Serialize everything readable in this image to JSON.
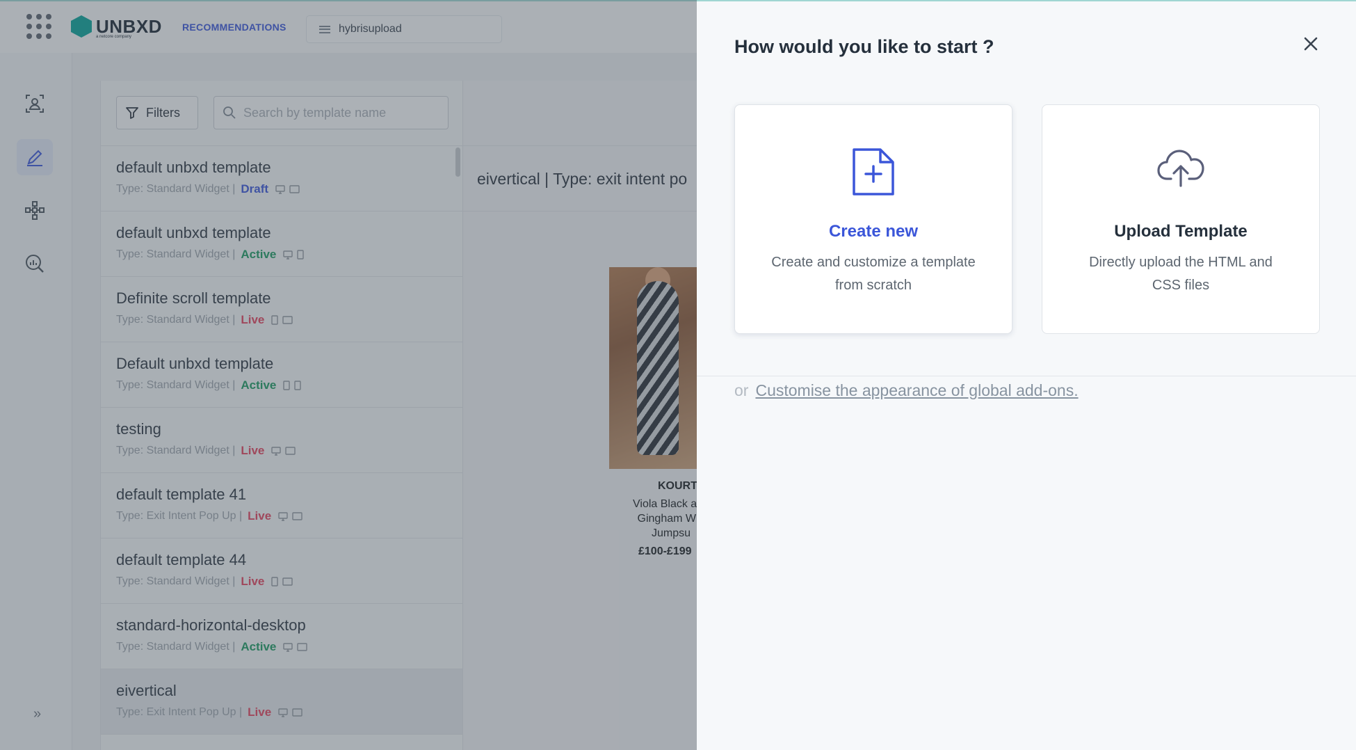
{
  "topbar": {
    "brand": "UNBXD",
    "brand_sub": "a netcore company",
    "nav_active": "RECOMMENDATIONS",
    "site_name": "hybrisupload"
  },
  "sidebar": {
    "items": [
      {
        "icon": "user-frame-icon"
      },
      {
        "icon": "pencil-icon",
        "active": true
      },
      {
        "icon": "network-icon"
      },
      {
        "icon": "analytics-icon"
      }
    ],
    "expand_label": "»"
  },
  "list": {
    "filters_label": "Filters",
    "search_placeholder": "Search by template name",
    "items": [
      {
        "name": "default unbxd template",
        "type": "Type: Standard Widget |",
        "status": "Draft",
        "devices": [
          "desktop",
          "tablet"
        ]
      },
      {
        "name": "default unbxd template",
        "type": "Type: Standard Widget |",
        "status": "Active",
        "devices": [
          "desktop",
          "mobile"
        ]
      },
      {
        "name": "Definite scroll template",
        "type": "Type: Standard Widget |",
        "status": "Live",
        "devices": [
          "mobile",
          "tablet"
        ]
      },
      {
        "name": "Default unbxd template",
        "type": "Type: Standard Widget |",
        "status": "Active",
        "devices": [
          "mobile",
          "mobile"
        ]
      },
      {
        "name": "testing",
        "type": "Type: Standard Widget |",
        "status": "Live",
        "devices": [
          "desktop",
          "tablet"
        ]
      },
      {
        "name": "default template 41",
        "type": "Type: Exit Intent Pop Up |",
        "status": "Live",
        "devices": [
          "desktop",
          "tablet"
        ]
      },
      {
        "name": "default template 44",
        "type": "Type: Standard Widget |",
        "status": "Live",
        "devices": [
          "mobile",
          "tablet"
        ]
      },
      {
        "name": "standard-horizontal-desktop",
        "type": "Type: Standard Widget |",
        "status": "Active",
        "devices": [
          "desktop",
          "tablet"
        ]
      },
      {
        "name": "eivertical",
        "type": "Type: Exit Intent Pop Up |",
        "status": "Live",
        "devices": [
          "desktop",
          "tablet"
        ],
        "selected": true
      }
    ]
  },
  "preview": {
    "title": "eivertical | Type: exit intent po",
    "product": {
      "brand": "KOURT",
      "name": "Viola Black and Gingham Wid Jumpsu",
      "price": "£100-£199"
    }
  },
  "drawer": {
    "title": "How would you like to start ?",
    "cards": [
      {
        "title": "Create new",
        "desc": "Create and customize a template from scratch",
        "icon": "file-plus-icon"
      },
      {
        "title": "Upload Template",
        "desc": "Directly upload the HTML and CSS files",
        "icon": "cloud-upload-icon"
      }
    ],
    "or_text": "or",
    "global_link": "Customise the appearance of global add-ons."
  },
  "colors": {
    "accent": "#3b56d9",
    "brand": "#0aa39a",
    "active": "#1c9a62",
    "live": "#e0445f"
  }
}
